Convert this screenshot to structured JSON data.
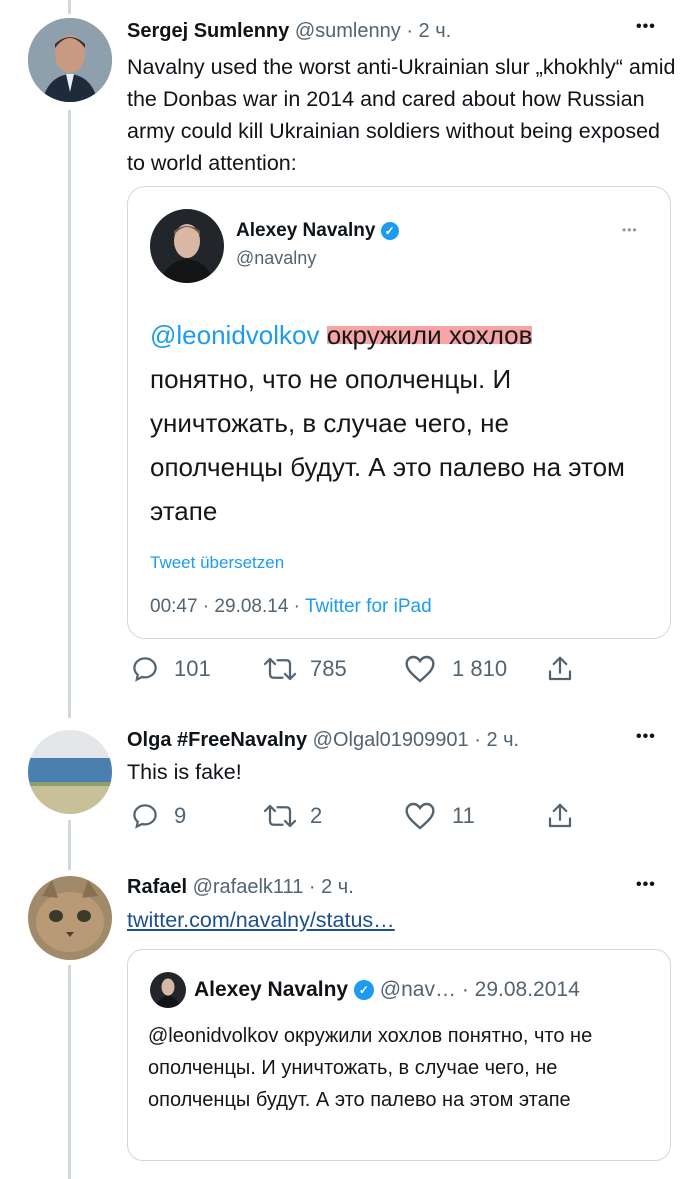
{
  "tweet1": {
    "author_name": "Sergej Sumlenny",
    "handle": "@sumlenny",
    "sep": "·",
    "time": "2 ч.",
    "more": "•••",
    "text": "Navalny used the worst anti-Ukrainian slur „khokhly“ amid the Donbas war in 2014 and cared about how Russian army could kill Ukrainian soldiers without being exposed to world attention:",
    "quoted": {
      "author_name": "Alexey Navalny",
      "handle": "@navalny",
      "more": "•••",
      "mention": "@leonidvolkov",
      "highlighted_text": "окружили хохлов",
      "text_rest": "понятно, что не ополченцы. И уничтожать, в случае чего, не ополченцы будут. А это палево на этом этапе",
      "translate": "Tweet übersetzen",
      "timestamp": "00:47 · 29.08.14 ·",
      "source": "Twitter for iPad"
    },
    "actions": {
      "replies": "101",
      "retweets": "785",
      "likes": "1 810"
    }
  },
  "tweet2": {
    "author_name": "Olga #FreeNavalny",
    "handle": "@Olgal01909901",
    "sep": "·",
    "time": "2 ч.",
    "more": "•••",
    "text": "This is fake!",
    "actions": {
      "replies": "9",
      "retweets": "2",
      "likes": "11"
    }
  },
  "tweet3": {
    "author_name": "Rafael",
    "handle": "@rafaelk111",
    "sep": "·",
    "time": "2 ч.",
    "more": "•••",
    "link": "twitter.com/navalny/status…",
    "quoted": {
      "author_name": "Alexey Navalny",
      "handle": "@nav…",
      "sep": "·",
      "date": "29.08.2014",
      "text": "@leonidvolkov окружили хохлов понятно, что не ополченцы. И уничтожать, в случае чего, не ополченцы будут. А это палево на этом этапе"
    }
  },
  "colors": {
    "accent": "#1d9bf0",
    "muted": "#536471",
    "border": "#cfd9de",
    "highlight": "#f05a5a"
  }
}
